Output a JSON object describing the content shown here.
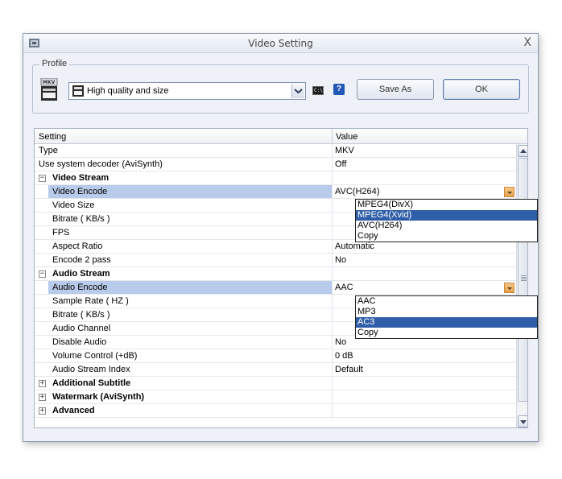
{
  "window": {
    "title": "Video Setting",
    "close_glyph": "X"
  },
  "profile": {
    "legend": "Profile",
    "selected": "High quality and size",
    "help_glyph": "?",
    "cmd_glyph": "C:\\\\"
  },
  "buttons": {
    "save_as": "Save As",
    "ok": "OK"
  },
  "grid": {
    "header_setting": "Setting",
    "header_value": "Value",
    "rows": [
      {
        "label": "Type",
        "value": "MKV"
      },
      {
        "label": "Use system decoder (AviSynth)",
        "value": "Off"
      },
      {
        "label": "Video Stream",
        "value": "",
        "expander": "−"
      },
      {
        "label": "Video Encode",
        "value": "AVC(H264)"
      },
      {
        "label": "Video Size",
        "value": ""
      },
      {
        "label": "Bitrate ( KB/s )",
        "value": ""
      },
      {
        "label": "FPS",
        "value": ""
      },
      {
        "label": "Aspect Ratio",
        "value": "Automatic"
      },
      {
        "label": "Encode 2 pass",
        "value": "No"
      },
      {
        "label": "Audio Stream",
        "value": "",
        "expander": "−"
      },
      {
        "label": "Audio Encode",
        "value": "AAC"
      },
      {
        "label": "Sample Rate ( HZ )",
        "value": ""
      },
      {
        "label": "Bitrate ( KB/s )",
        "value": ""
      },
      {
        "label": "Audio Channel",
        "value": ""
      },
      {
        "label": "Disable Audio",
        "value": "No"
      },
      {
        "label": "Volume Control (+dB)",
        "value": "0 dB"
      },
      {
        "label": "Audio Stream Index",
        "value": "Default"
      },
      {
        "label": "Additional Subtitle",
        "value": "",
        "expander": "+"
      },
      {
        "label": "Watermark (AviSynth)",
        "value": "",
        "expander": "+"
      },
      {
        "label": "Advanced",
        "value": "",
        "expander": "+"
      }
    ]
  },
  "video_encode_options": [
    "MPEG4(DivX)",
    "MPEG4(Xvid)",
    "AVC(H264)",
    "Copy"
  ],
  "video_encode_highlighted": "MPEG4(Xvid)",
  "audio_encode_options": [
    "AAC",
    "MP3",
    "AC3",
    "Copy"
  ],
  "audio_encode_highlighted": "AC3",
  "colors": {
    "selection": "#2f5ea8",
    "row_highlight": "#b9cbea",
    "dropdown_arrow": "#e3a14c"
  }
}
